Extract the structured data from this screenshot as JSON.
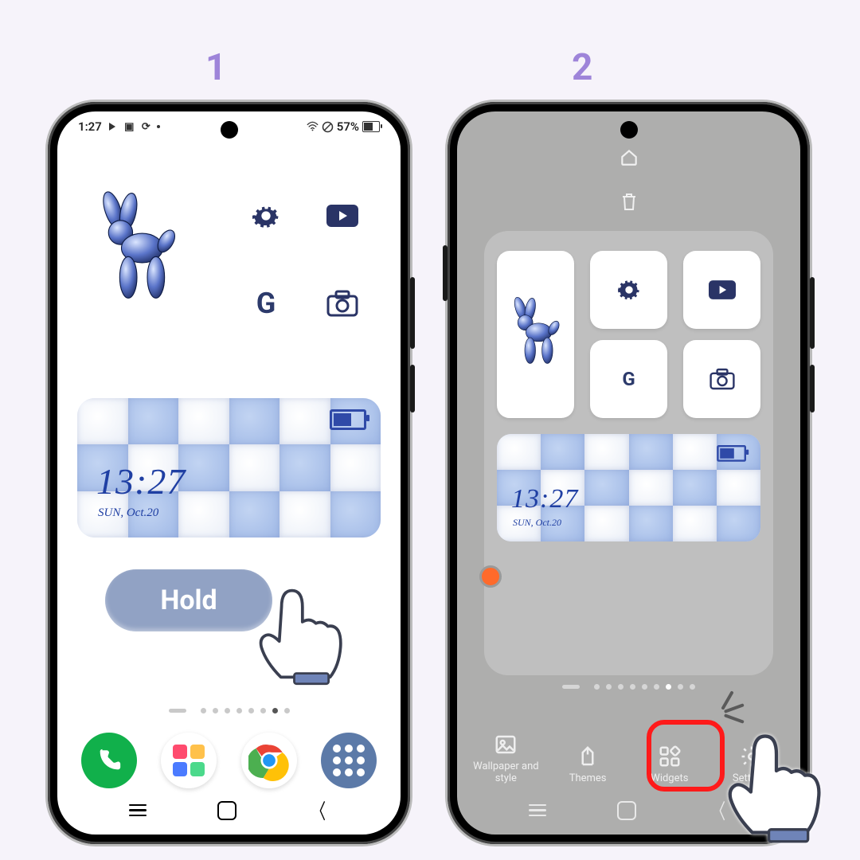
{
  "steps": {
    "one": "1",
    "two": "2"
  },
  "status": {
    "time": "1:27",
    "battery_pct": "57%"
  },
  "icons": {
    "settings": "settings",
    "video": "video",
    "google_g": "G",
    "camera": "camera"
  },
  "widget": {
    "time": "13:27",
    "date": "SUN, Oct.20"
  },
  "overlay": {
    "hold_label": "Hold"
  },
  "dock": {
    "phone": "Phone",
    "widgetsmith": "Widgets",
    "chrome": "Chrome",
    "apps": "Apps"
  },
  "edit_toolbar": {
    "wallpaper": "Wallpaper and style",
    "themes": "Themes",
    "widgets": "Widgets",
    "settings": "Settings"
  }
}
